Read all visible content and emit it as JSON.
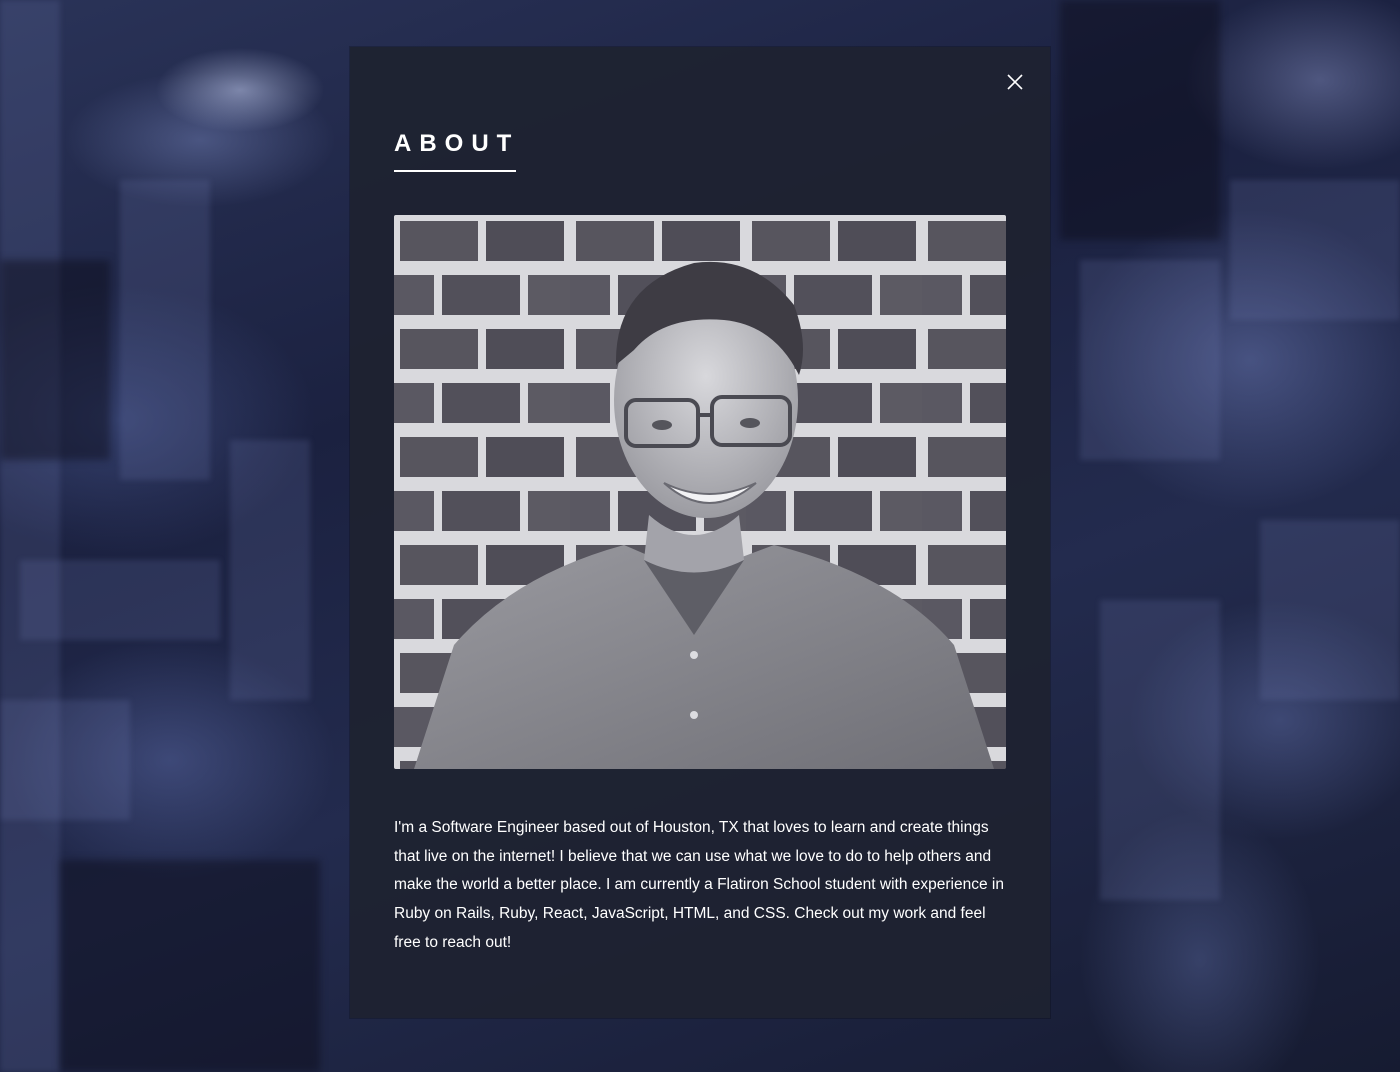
{
  "modal": {
    "title": "ABOUT",
    "close_icon": "close-icon",
    "photo": {
      "description_icon": "profile-photo"
    },
    "bio": "I'm a Software Engineer based out of Houston, TX that loves to learn and create things that live on the internet! I believe that we can use what we love to do to help others and make the world a better place. I am currently a Flatiron School student with experience in Ruby on Rails, Ruby, React, JavaScript, HTML, and CSS. Check out my work and feel free to reach out!"
  },
  "colors": {
    "modal_background": "#1e2230",
    "text": "#ffffff",
    "page_background": "#151a2c"
  }
}
